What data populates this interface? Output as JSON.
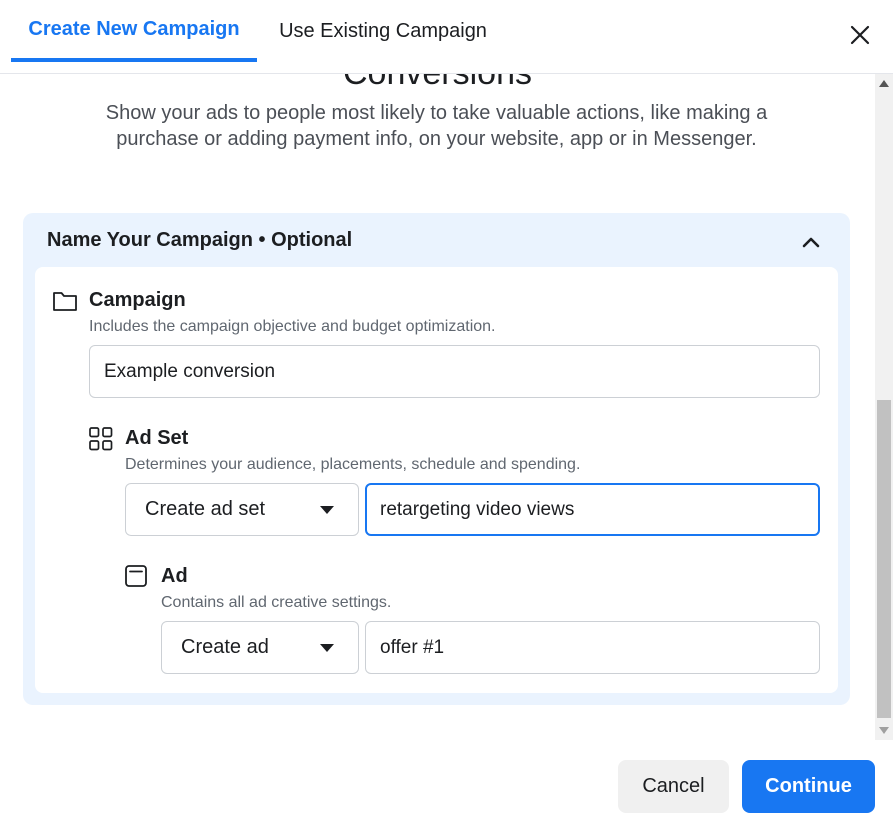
{
  "tabs": {
    "create_new": "Create New Campaign",
    "use_existing": "Use Existing Campaign"
  },
  "objective": {
    "title": "Conversions",
    "description": "Show your ads to people most likely to take valuable actions, like making a purchase or adding payment info, on your website, app or in Messenger."
  },
  "panel": {
    "header": "Name Your Campaign • Optional",
    "campaign": {
      "title": "Campaign",
      "description": "Includes the campaign objective and budget optimization.",
      "name_value": "Example conversion"
    },
    "ad_set": {
      "title": "Ad Set",
      "description": "Determines your audience, placements, schedule and spending.",
      "select_value": "Create ad set",
      "name_value": "retargeting video views"
    },
    "ad": {
      "title": "Ad",
      "description": "Contains all ad creative settings.",
      "select_value": "Create ad",
      "name_value": "offer #1"
    }
  },
  "footer": {
    "cancel_label": "Cancel",
    "continue_label": "Continue"
  },
  "colors": {
    "accent": "#1877f2",
    "panel_bg": "#eaf3fe"
  }
}
